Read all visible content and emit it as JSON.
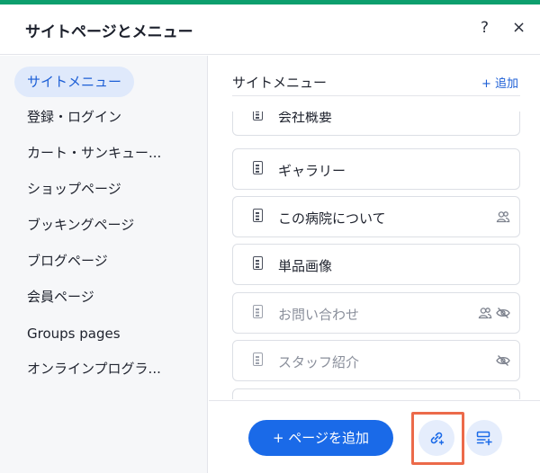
{
  "header": {
    "title": "サイトページとメニュー",
    "help_label": "?",
    "close_label": "×"
  },
  "sidebar": {
    "items": [
      {
        "label": "サイトメニュー",
        "active": true
      },
      {
        "label": "登録・ログイン"
      },
      {
        "label": "カート・サンキュー..."
      },
      {
        "label": "ショップページ"
      },
      {
        "label": "ブッキングページ"
      },
      {
        "label": "ブログページ"
      },
      {
        "label": "会員ページ"
      },
      {
        "label": "Groups pages"
      },
      {
        "label": "オンラインプログラ..."
      }
    ]
  },
  "main": {
    "title": "サイトメニュー",
    "add_label": "+ 追加",
    "pages": [
      {
        "label": "会社概要",
        "hidden": false,
        "members_only": false
      },
      {
        "label": "ギャラリー",
        "hidden": false,
        "members_only": false
      },
      {
        "label": "この病院について",
        "hidden": false,
        "members_only": true
      },
      {
        "label": "単品画像",
        "hidden": false,
        "members_only": false
      },
      {
        "label": "お問い合わせ",
        "hidden": true,
        "members_only": true
      },
      {
        "label": "スタッフ紹介",
        "hidden": true,
        "members_only": false
      }
    ]
  },
  "footer": {
    "add_page_label": "+ ページを追加",
    "link_button_icon": "link-add-icon",
    "menu_button_icon": "menu-add-icon"
  },
  "colors": {
    "accent": "#1a6ae8",
    "top_bar": "#0d9f6e",
    "highlight": "#ec6a4a"
  }
}
